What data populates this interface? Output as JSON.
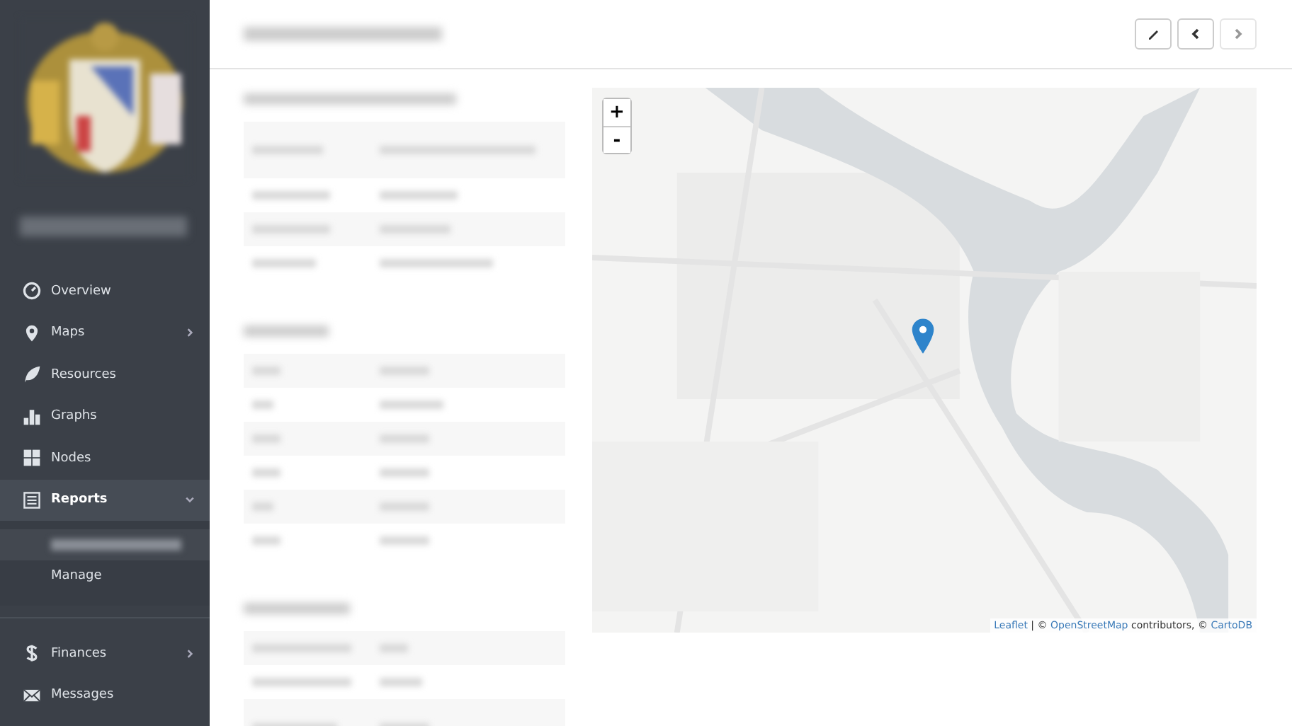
{
  "sidebar": {
    "items": [
      {
        "kind": "item",
        "label": "Overview",
        "selected": false
      },
      {
        "kind": "item",
        "label": "Maps",
        "expanded": false,
        "selected": false
      },
      {
        "kind": "item",
        "label": "Resources",
        "selected": false
      },
      {
        "kind": "item",
        "label": "Graphs",
        "selected": false
      },
      {
        "kind": "item",
        "label": "Nodes",
        "selected": false
      },
      {
        "kind": "item",
        "label": "Reports",
        "expanded": true,
        "selected": true,
        "children": [
          {
            "selected": true
          },
          {
            "label": "Manage",
            "selected": false
          }
        ]
      },
      {
        "kind": "divider"
      },
      {
        "kind": "item",
        "label": "Finances",
        "expanded": false,
        "selected": false
      },
      {
        "kind": "item",
        "label": "Messages",
        "selected": false
      }
    ]
  },
  "toolbar": [
    {
      "disabled": false
    },
    {
      "disabled": false
    },
    {
      "disabled": true
    }
  ],
  "map": {
    "zoom_in": "+",
    "zoom_out": "-",
    "attribution": [
      {
        "kind": "link",
        "text": "Leaflet"
      },
      {
        "kind": "text",
        "text": " | © "
      },
      {
        "kind": "link",
        "text": "OpenStreetMap"
      },
      {
        "kind": "text",
        "text": " contributors, © "
      },
      {
        "kind": "link",
        "text": "CartoDB"
      }
    ]
  }
}
